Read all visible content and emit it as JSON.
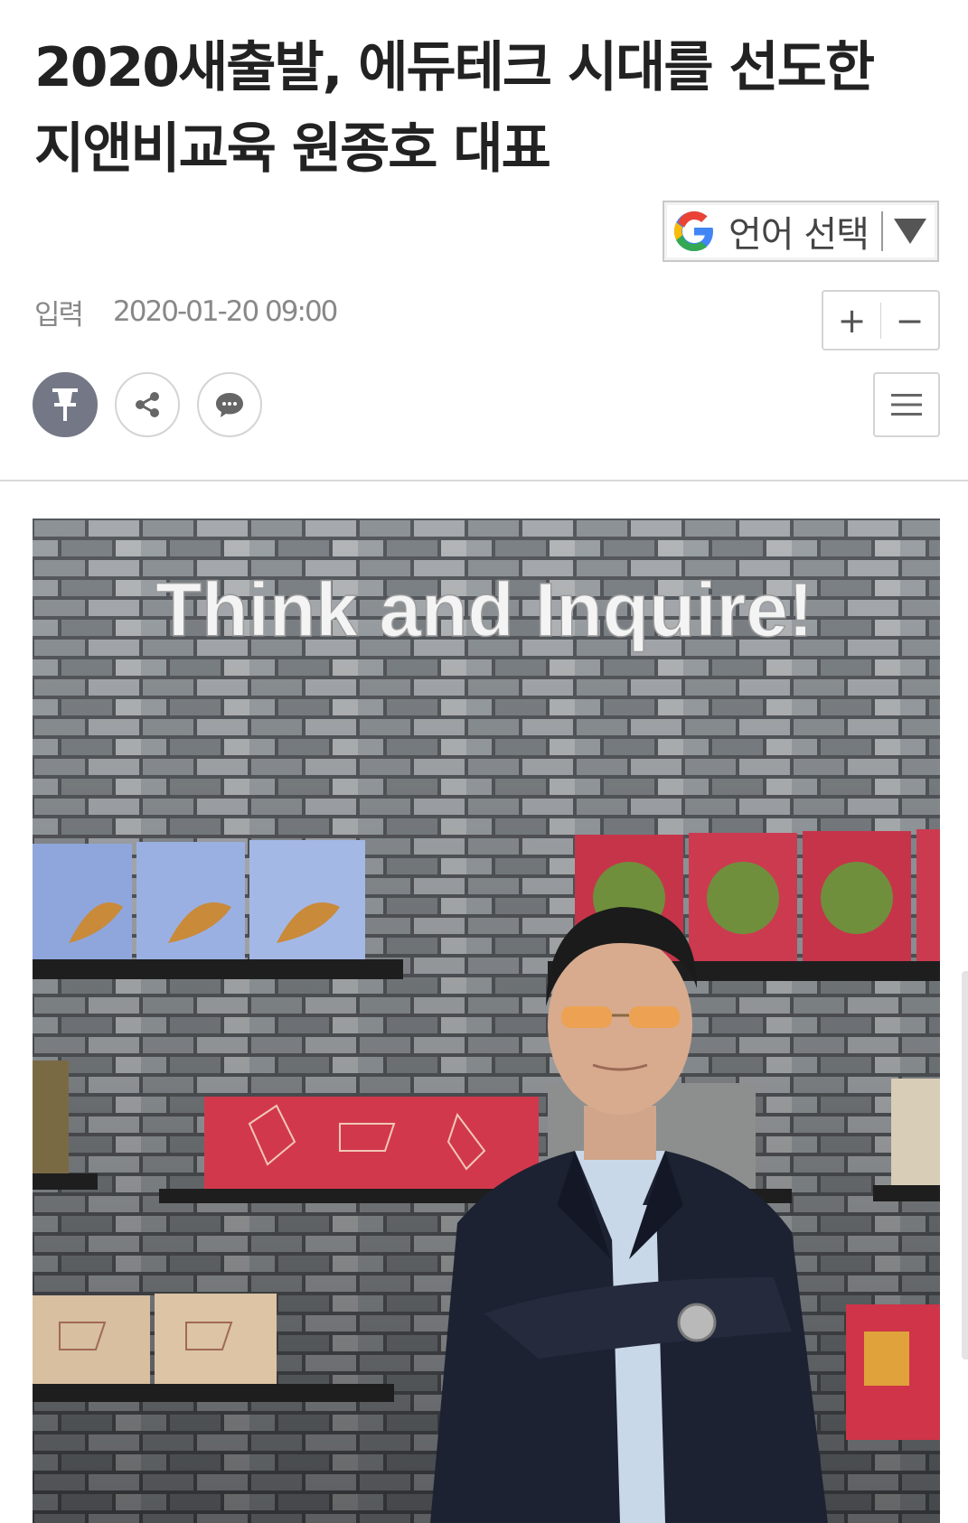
{
  "article": {
    "title": "2020새출발, 에듀테크 시대를 선도한 지앤비교육 원종호 대표",
    "input_label": "입력",
    "published": "2020-01-20 09:00"
  },
  "translate": {
    "label": "언어 선택",
    "icon": "google-g-icon"
  },
  "font_size": {
    "increase": "+",
    "decrease": "−"
  },
  "actions": {
    "pin_icon": "pin-icon",
    "share_icon": "share-icon",
    "comment_icon": "comment-icon",
    "menu_icon": "hamburger-menu-icon"
  },
  "photo": {
    "sign_text": "Think and Inquire!"
  },
  "colors": {
    "pin_button": "#747886",
    "border": "#d4d4d4",
    "title": "#222222",
    "meta": "#888888"
  }
}
